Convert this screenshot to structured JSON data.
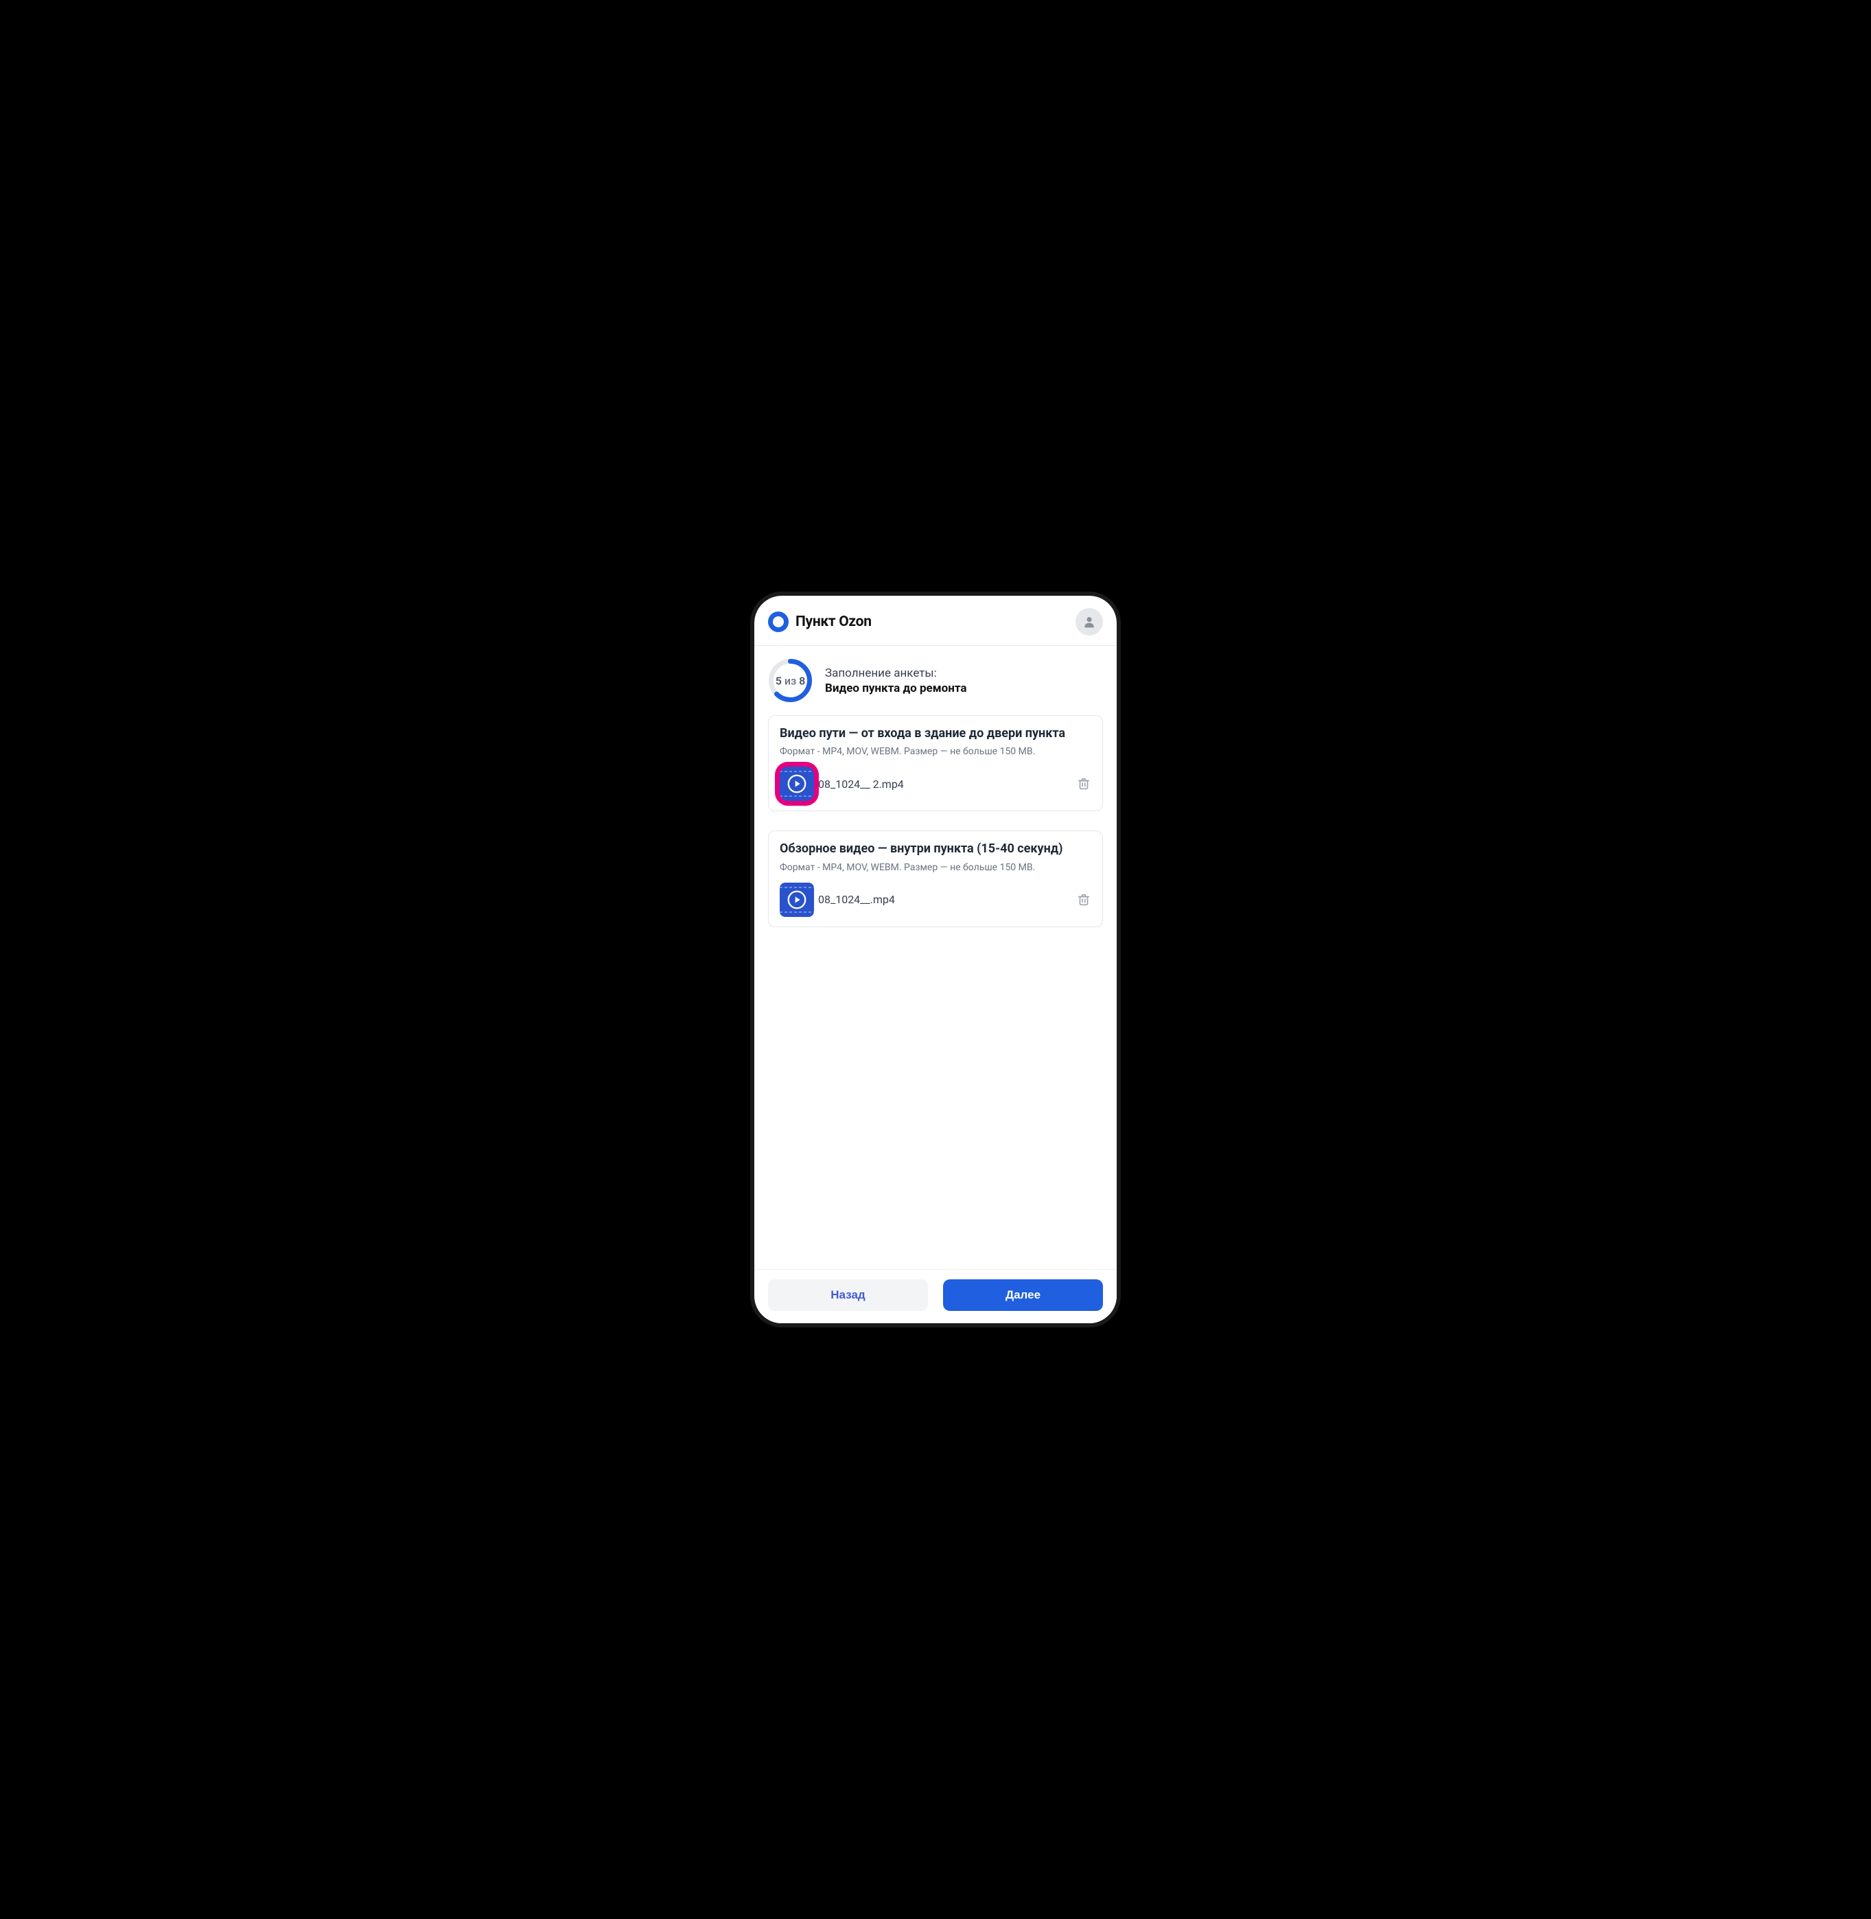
{
  "header": {
    "title": "Пункт Ozon"
  },
  "progress": {
    "current": "5",
    "separator": "из",
    "total": "8",
    "label_top": "Заполнение анкеты:",
    "label_bottom": "Видео пункта до ремонта"
  },
  "cards": [
    {
      "title": "Видео пути — от входа в здание до двери пункта",
      "subtitle": "Формат - MP4, MOV, WEBM. Размер — не больше 150 MB.",
      "file_name": "08_1024__ 2.mp4",
      "highlighted": true
    },
    {
      "title": "Обзорное видео — внутри пункта (15-40 секунд)",
      "subtitle": "Формат - MP4, MOV, WEBM. Размер — не больше 150 MB.",
      "file_name": "08_1024__.mp4",
      "highlighted": false
    }
  ],
  "footer": {
    "back_label": "Назад",
    "next_label": "Далее"
  }
}
